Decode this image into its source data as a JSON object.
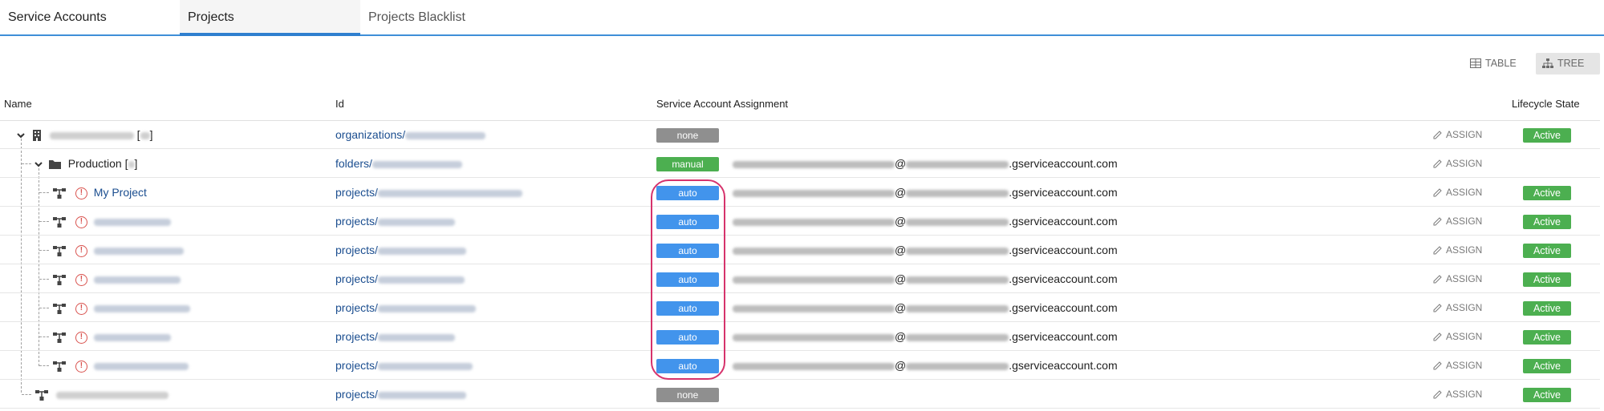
{
  "tabs": [
    {
      "label": "Service Accounts"
    },
    {
      "label": "Projects"
    },
    {
      "label": "Projects Blacklist"
    }
  ],
  "view_toggle": {
    "table_label": "TABLE",
    "tree_label": "TREE",
    "selected": "TREE"
  },
  "columns": {
    "name": "Name",
    "id": "Id",
    "assignment": "Service Account Assignment",
    "lifecycle": "Lifecycle State"
  },
  "colors": {
    "accent": "#2f7fcf",
    "active": "#4caf50",
    "auto": "#4294ec",
    "none": "#8f8f8f",
    "highlight": "#d6336c"
  },
  "rows": [
    {
      "type": "organization",
      "name": "[",
      "name_suffix": "]",
      "id_prefix": "organizations/",
      "assignment": "none",
      "account_suffix": "",
      "assign_label": "ASSIGN",
      "lifecycle": "Active"
    },
    {
      "type": "folder",
      "name": "Production [",
      "name_suffix": "]",
      "id_prefix": "folders/",
      "assignment": "manual",
      "account_at": "@",
      "account_suffix": ".gserviceaccount.com",
      "assign_label": "ASSIGN",
      "lifecycle": ""
    },
    {
      "type": "project",
      "name": "My Project",
      "id_prefix": "projects/",
      "assignment": "auto",
      "account_at": "@",
      "account_suffix": ".gserviceaccount.com",
      "assign_label": "ASSIGN",
      "lifecycle": "Active"
    },
    {
      "type": "project",
      "name": "",
      "id_prefix": "projects/",
      "assignment": "auto",
      "account_at": "@",
      "account_suffix": ".gserviceaccount.com",
      "assign_label": "ASSIGN",
      "lifecycle": "Active"
    },
    {
      "type": "project",
      "name": "",
      "id_prefix": "projects/",
      "assignment": "auto",
      "account_at": "@",
      "account_suffix": ".gserviceaccount.com",
      "assign_label": "ASSIGN",
      "lifecycle": "Active"
    },
    {
      "type": "project",
      "name": "",
      "id_prefix": "projects/",
      "assignment": "auto",
      "account_at": "@",
      "account_suffix": ".gserviceaccount.com",
      "assign_label": "ASSIGN",
      "lifecycle": "Active"
    },
    {
      "type": "project",
      "name": "",
      "id_prefix": "projects/",
      "assignment": "auto",
      "account_at": "@",
      "account_suffix": ".gserviceaccount.com",
      "assign_label": "ASSIGN",
      "lifecycle": "Active"
    },
    {
      "type": "project",
      "name": "",
      "id_prefix": "projects/",
      "assignment": "auto",
      "account_at": "@",
      "account_suffix": ".gserviceaccount.com",
      "assign_label": "ASSIGN",
      "lifecycle": "Active"
    },
    {
      "type": "project",
      "name": "",
      "id_prefix": "projects/",
      "assignment": "auto",
      "account_at": "@",
      "account_suffix": ".gserviceaccount.com",
      "assign_label": "ASSIGN",
      "lifecycle": "Active"
    },
    {
      "type": "project-root",
      "name": "",
      "id_prefix": "projects/",
      "assignment": "none",
      "account_suffix": "",
      "assign_label": "ASSIGN",
      "lifecycle": "Active"
    }
  ]
}
